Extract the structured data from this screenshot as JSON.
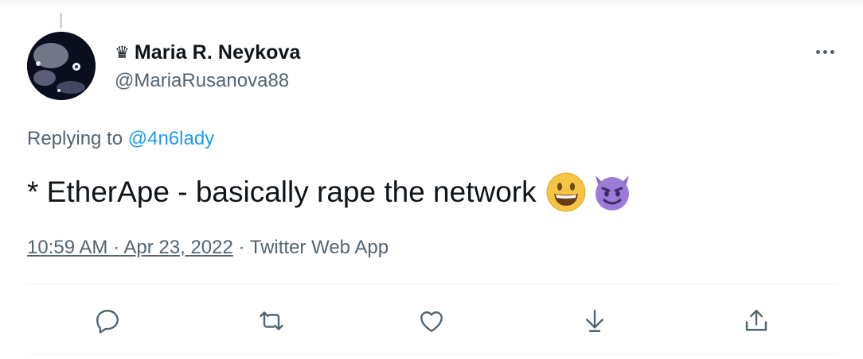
{
  "author": {
    "display_name": "Maria R. Neykova",
    "handle": "@MariaRusanova88",
    "badge_icon": "crown-icon",
    "badge_glyph": "♛"
  },
  "reply": {
    "prefix": "Replying to ",
    "mention": "@4n6lady"
  },
  "tweet": {
    "text": "* EtherApe - basically rape the network",
    "emojis": [
      "grinning-face-emoji",
      "smiling-devil-emoji"
    ]
  },
  "meta": {
    "time_date": "10:59 AM · Apr 23, 2022",
    "separator": " · ",
    "source": "Twitter Web App"
  },
  "actions": [
    {
      "name": "reply-icon"
    },
    {
      "name": "retweet-icon"
    },
    {
      "name": "like-icon"
    },
    {
      "name": "bookmark-download-icon"
    },
    {
      "name": "share-icon"
    }
  ],
  "colors": {
    "link": "#1d9bf0",
    "secondary_text": "#536471",
    "primary_text": "#0f1419",
    "icon": "#536471"
  }
}
